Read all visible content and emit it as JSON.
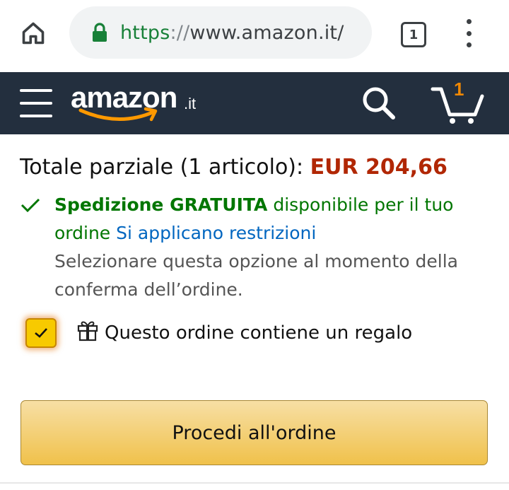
{
  "browser": {
    "url_scheme": "https",
    "url_separator": "://",
    "url_host": "www.amazon.it/",
    "tab_count": "1",
    "icons": {
      "home": "home-icon",
      "lock": "lock-icon",
      "menu": "more-vert-icon"
    }
  },
  "nav": {
    "logo_word": "amazon",
    "logo_tld": ".it",
    "cart_count": "1",
    "icons": {
      "menu": "hamburger-icon",
      "search": "search-icon",
      "cart": "cart-icon"
    }
  },
  "cart": {
    "subtotal_label": "Totale parziale (1 articolo):",
    "subtotal_price": "EUR 204,66",
    "shipping_bold": "Spedizione GRATUITA",
    "shipping_text": "disponibile per il tuo ordine",
    "shipping_link": "Si applicano restrizioni",
    "shipping_note": "Selezionare questa opzione al momento della conferma dell’ordine.",
    "gift_checked": true,
    "gift_label": "Questo ordine contiene un regalo",
    "proceed_label": "Procedi all'ordine"
  },
  "colors": {
    "nav_bg": "#232f3e",
    "price": "#b12704",
    "shipping_green": "#007600",
    "link_blue": "#0066c0",
    "button_yellow": "#f0c14b",
    "smile_orange": "#ff9900"
  }
}
